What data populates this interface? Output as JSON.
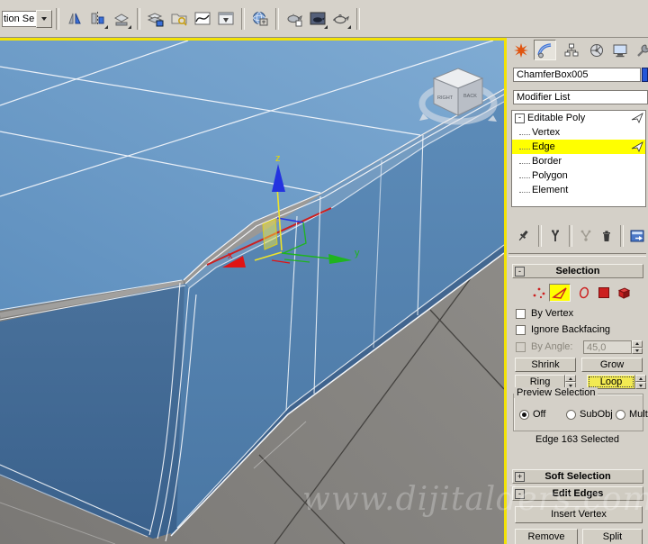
{
  "toolbar": {
    "selection_sets_value": "tion Se",
    "icons": [
      "named-selection-sets",
      "mirror",
      "align",
      "layer-properties",
      "layer-manager",
      "scene-explorer",
      "curve-editor",
      "schematic-view",
      "material-editor",
      "render-setup",
      "rendered-frame-window",
      "render-production"
    ]
  },
  "command_panel": {
    "tab_icons": [
      "create",
      "modify",
      "hierarchy",
      "motion",
      "display",
      "utilities"
    ],
    "active_tab": "modify",
    "object_name": "ChamferBox005",
    "modifier_list_label": "Modifier List",
    "stack": {
      "items": [
        {
          "label": "Editable Poly",
          "expand_symbol": "-"
        },
        {
          "label": "Vertex"
        },
        {
          "label": "Edge",
          "selected": true
        },
        {
          "label": "Border"
        },
        {
          "label": "Polygon"
        },
        {
          "label": "Element"
        }
      ]
    },
    "stack_tool_icons": [
      "pin-stack",
      "show-end-result",
      "make-unique",
      "remove-modifier",
      "configure-modifier-sets"
    ],
    "selection": {
      "title": "Selection",
      "collapse_symbol": "-",
      "subobject_icons": [
        "vertex",
        "edge",
        "border",
        "polygon",
        "element"
      ],
      "active_subobject": "edge",
      "by_vertex_label": "By Vertex",
      "ignore_backfacing_label": "Ignore Backfacing",
      "by_angle_label": "By Angle:",
      "by_angle_value": "45,0",
      "shrink_label": "Shrink",
      "grow_label": "Grow",
      "ring_label": "Ring",
      "loop_label": "Loop",
      "preview": {
        "title": "Preview Selection",
        "off": "Off",
        "subobj": "SubObj",
        "multi": "Multi",
        "selected": "Off"
      },
      "status": "Edge 163 Selected"
    },
    "soft_selection": {
      "title": "Soft Selection",
      "expand_symbol": "+"
    },
    "edit_edges": {
      "title": "Edit Edges",
      "collapse_symbol": "-",
      "insert_vertex_label": "Insert Vertex",
      "remove_label": "Remove",
      "split_label": "Split"
    }
  },
  "viewport": {
    "axis_x": "x",
    "axis_y": "y",
    "axis_z": "z",
    "viewcube_left_face": "RIGHT",
    "viewcube_right_face": "BACK",
    "watermark": "www.dijitalders.com",
    "colors": {
      "active_border": "#f2e206",
      "selected_edge": "#cc1f1f",
      "box_top": "#6d9cc8",
      "box_left": "#416892",
      "box_right": "#537fab",
      "ground": "#8b8985",
      "gizmo_x": "#e01414",
      "gizmo_y": "#1fb41f",
      "gizmo_z": "#2433e0",
      "gizmo_active": "#efe32a",
      "subobject_highlight": "#ffff00"
    }
  }
}
